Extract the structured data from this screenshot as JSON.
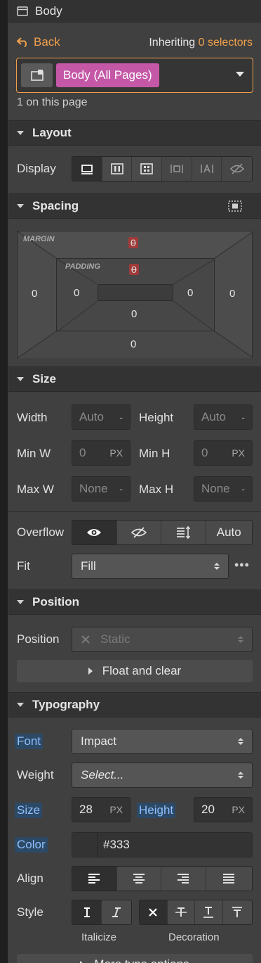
{
  "header": {
    "title": "Body",
    "icon": "window-icon"
  },
  "selector_bar": {
    "back_label": "Back",
    "inheriting_label": "Inheriting",
    "inheriting_count": "0 selectors",
    "selector_tag": "Body (All Pages)",
    "on_page": "1 on this page"
  },
  "layout": {
    "title": "Layout",
    "display_label": "Display",
    "display_options": [
      "block-icon",
      "flex-icon",
      "grid-icon",
      "inline-block-icon",
      "inline-icon",
      "none-icon"
    ]
  },
  "spacing": {
    "title": "Spacing",
    "margin_label": "MARGIN",
    "padding_label": "PADDING",
    "margin": {
      "top": "0",
      "right": "0",
      "bottom": "0",
      "left": "0"
    },
    "padding": {
      "top": "0",
      "right": "0",
      "bottom": "0",
      "left": "0"
    }
  },
  "size": {
    "title": "Size",
    "width_label": "Width",
    "width_value": "Auto",
    "width_unit": "-",
    "height_label": "Height",
    "height_value": "Auto",
    "height_unit": "-",
    "minw_label": "Min W",
    "minw_value": "0",
    "minw_unit": "PX",
    "minh_label": "Min H",
    "minh_value": "0",
    "minh_unit": "PX",
    "maxw_label": "Max W",
    "maxw_value": "None",
    "maxw_unit": "-",
    "maxh_label": "Max H",
    "maxh_value": "None",
    "maxh_unit": "-",
    "overflow_label": "Overflow",
    "overflow_auto": "Auto",
    "fit_label": "Fit",
    "fit_value": "Fill"
  },
  "position": {
    "title": "Position",
    "position_label": "Position",
    "position_value": "Static",
    "float_label": "Float and clear"
  },
  "typography": {
    "title": "Typography",
    "font_label": "Font",
    "font_value": "Impact",
    "weight_label": "Weight",
    "weight_value": "Select...",
    "size_label": "Size",
    "size_value": "28",
    "size_unit": "PX",
    "height_label": "Height",
    "height_value": "20",
    "height_unit": "PX",
    "color_label": "Color",
    "color_value": "#333",
    "align_label": "Align",
    "style_label": "Style",
    "italicize_caption": "Italicize",
    "decoration_caption": "Decoration",
    "more_label": "More type options"
  },
  "colors": {
    "accent_orange": "#f0a04b",
    "tag_pink": "#c458a7",
    "label_blue": "#8fc0ff"
  }
}
